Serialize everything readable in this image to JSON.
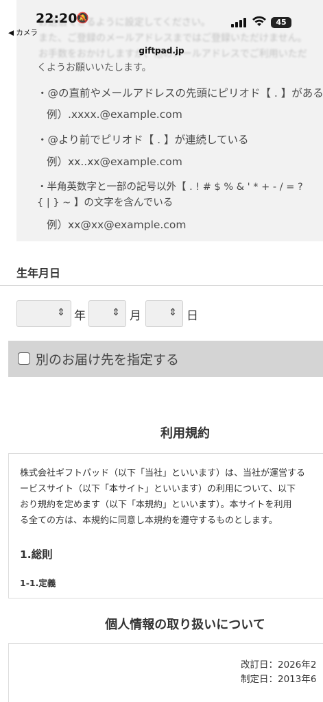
{
  "status_bar": {
    "time": "22:20",
    "back_app": "◀ カメラ",
    "battery": "45",
    "domain": "giftpad.jp"
  },
  "notice": {
    "blurred": [
      "お送信できるように設定してください。",
      "また、ご登録のメールアドレスまではご登録いただけません。",
      "お手数をおかけしますが、他のメールアドレスでご利用いただ"
    ],
    "intro_tail": "くようお願いいたします。",
    "rules": [
      {
        "text": "・@の直前やメールアドレスの先頭にピリオド【 . 】がある",
        "example": "例）.xxxx.@example.com"
      },
      {
        "text": "・@より前でピリオド【 . 】が連続している",
        "example": "例）xx..xx@example.com"
      },
      {
        "text": "・半角英数字と一部の記号以外【 . ! # $ % & ' * + - / = ?",
        "text2": "{ | } ~ 】の文字を含んでいる",
        "example": "例）xx@xx@example.com"
      }
    ]
  },
  "birthday": {
    "label": "生年月日",
    "year_unit": "年",
    "month_unit": "月",
    "day_unit": "日"
  },
  "alt_address": {
    "label": "別のお届け先を指定する"
  },
  "terms": {
    "heading": "利用規約",
    "lines": [
      "株式会社ギフトパッド（以下「当社」といいます）は、当社が運営する",
      "ービスサイト（以下「本サイト」といいます）の利用について、以下",
      "おり規約を定めます（以下「本規約」といいます）。本サイトを利用",
      "る全ての方は、本規約に同意し本規約を遵守するものとします。"
    ],
    "section": "1.総則",
    "subsection": "1-1.定義"
  },
  "privacy": {
    "heading": "個人情報の取り扱いについて",
    "revised": "改訂日：2026年2",
    "established": "制定日：2013年6"
  }
}
